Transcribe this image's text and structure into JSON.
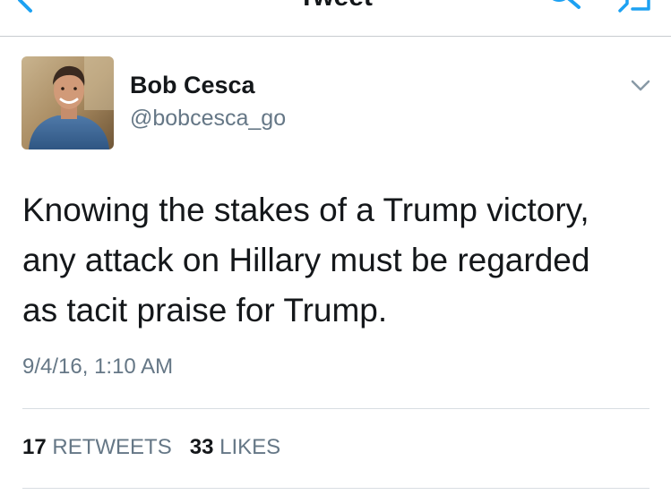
{
  "header": {
    "title": "Tweet",
    "accent_color": "#1da1f2",
    "icons": [
      "chevron-left-icon",
      "search-icon",
      "compose-icon"
    ]
  },
  "author": {
    "name": "Bob Cesca",
    "handle": "@bobcesca_go",
    "avatar_icon": "profile-photo"
  },
  "tweet": {
    "lines": [
      "Knowing the stakes of a Trump victory,",
      "any attack on Hillary must be regarded",
      "as tacit praise for Trump."
    ],
    "timestamp": "9/4/16, 1:10 AM"
  },
  "stats": {
    "retweets_count": "17",
    "retweets_label": "RETWEETS",
    "likes_count": "33",
    "likes_label": "LIKES"
  },
  "colors": {
    "text": "#14171a",
    "secondary_text": "#657786",
    "divider": "#d8dde2"
  }
}
